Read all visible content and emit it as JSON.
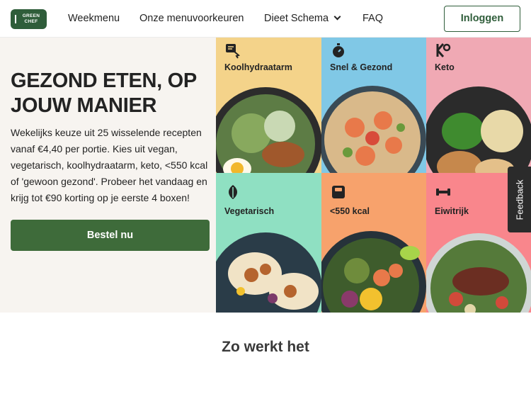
{
  "header": {
    "logo_text": "GREEN CHEF",
    "nav": [
      {
        "label": "Weekmenu"
      },
      {
        "label": "Onze menuvoorkeuren"
      },
      {
        "label": "Dieet Schema"
      },
      {
        "label": "FAQ"
      }
    ],
    "login_label": "Inloggen"
  },
  "hero": {
    "title": "GEZOND ETEN, OP JOUW MANIER",
    "description": "Wekelijks keuze uit 25 wisselende recepten vanaf €4,40 per portie. Kies uit vegan, vegetarisch, koolhydraatarm, keto, <550 kcal of 'gewoon gezond'. Probeer het vandaag en krijg tot €90 korting op je eerste 4 boxen!",
    "cta_label": "Bestel nu"
  },
  "tiles": [
    {
      "label": "Koolhydraatarm",
      "icon": "low-carb-icon",
      "bg": "#f4d38a"
    },
    {
      "label": "Snel & Gezond",
      "icon": "stopwatch-icon",
      "bg": "#80c8e6"
    },
    {
      "label": "Keto",
      "icon": "keto-icon",
      "bg": "#f0a9b4"
    },
    {
      "label": "Vegetarisch",
      "icon": "leaf-icon",
      "bg": "#8fe0c2"
    },
    {
      "label": "<550 kcal",
      "icon": "scale-icon",
      "bg": "#f7a26c"
    },
    {
      "label": "Eiwitrijk",
      "icon": "dumbbell-icon",
      "bg": "#f9868c"
    }
  ],
  "feedback_label": "Feedback",
  "section": {
    "title": "Zo werkt het"
  }
}
